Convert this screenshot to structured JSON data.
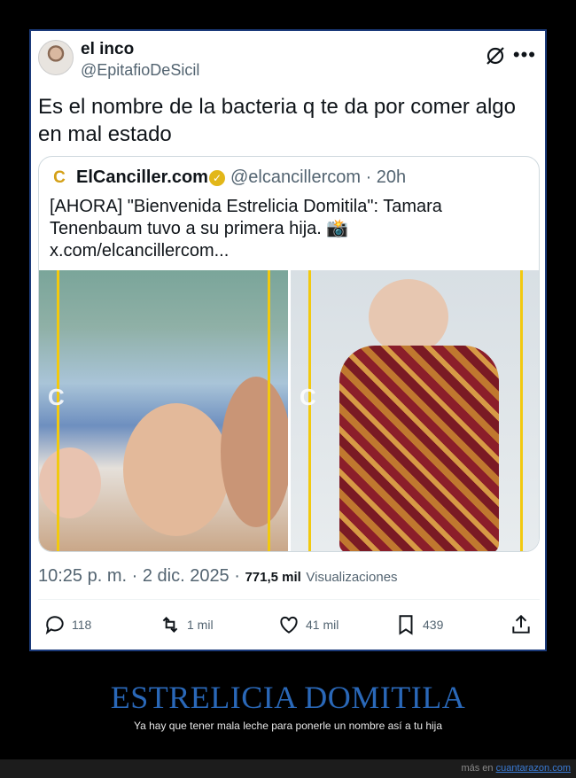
{
  "tweet": {
    "author_name": "el inco",
    "author_handle": "@EpitafioDeSicil",
    "text": "Es el nombre de la bacteria q te da por comer algo en mal estado",
    "timestamp": "10:25 p. m. · 2 dic. 2025 ·",
    "views_count": "771,5 mil",
    "views_label": "Visualizaciones",
    "icons": {
      "grok": "grok-icon",
      "more": "more-icon"
    }
  },
  "quote": {
    "logo_letter": "C",
    "author_name": "ElCanciller.com",
    "author_handle": "@elcancillercom · 20h",
    "text": "[AHORA] \"Bienvenida Estrelicia Domitila\": Tamara Tenenbaum tuvo a su primera hija. 📸",
    "link": "x.com/elcancillercom...",
    "verified_color": "#E2B719",
    "photo_watermark": "C",
    "accent_line_color": "#F2C90F"
  },
  "actions": {
    "replies": "118",
    "retweets": "1 mil",
    "likes": "41 mil",
    "bookmarks": "439"
  },
  "caption": {
    "title": "ESTRELICIA DOMITILA",
    "subtitle": "Ya hay que tener mala leche para ponerle un nombre así a tu hija",
    "title_color": "#2A68B8"
  },
  "footer": {
    "prefix": "más en",
    "link": "cuantarazon.com"
  }
}
